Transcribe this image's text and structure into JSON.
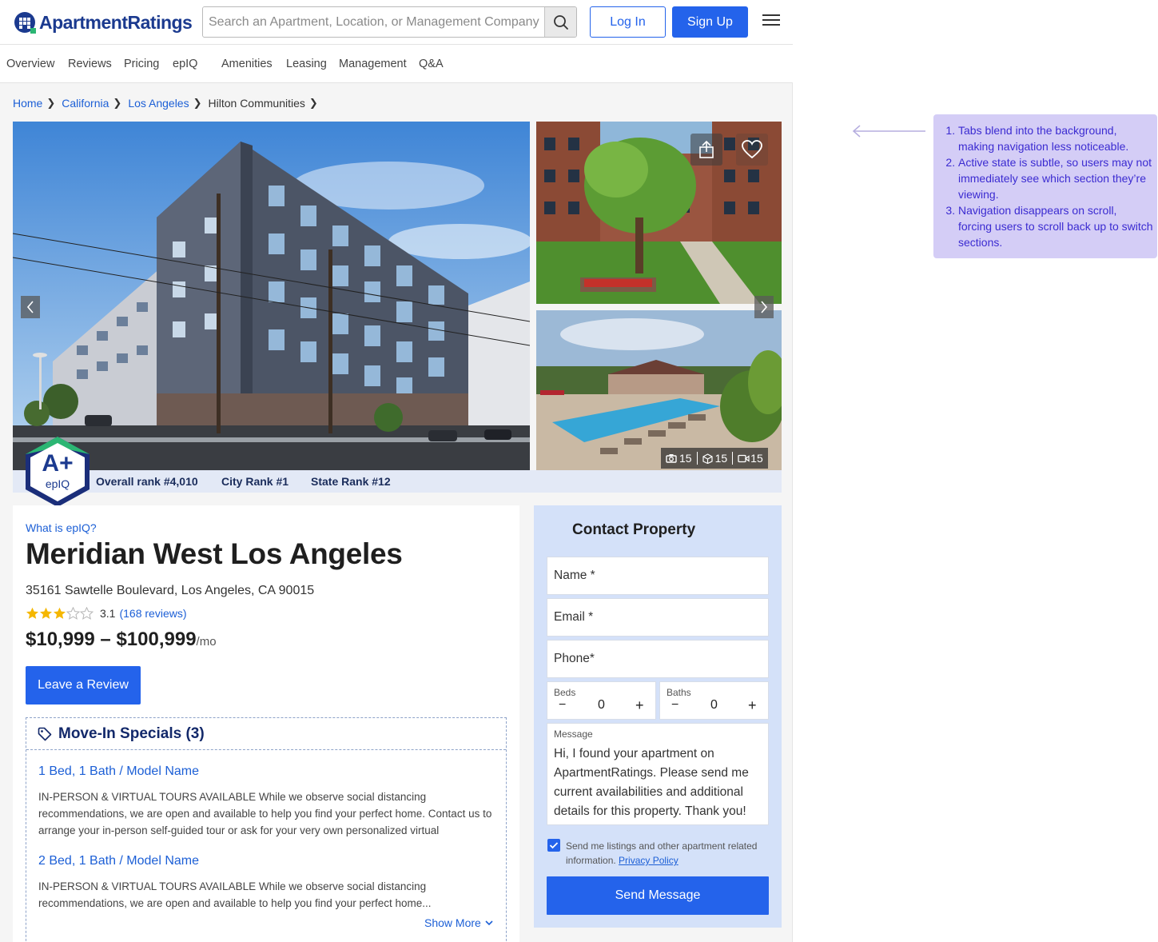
{
  "header": {
    "logo_text": "ApartmentRatings",
    "search_placeholder": "Search an Apartment, Location, or Management Company",
    "login_label": "Log In",
    "signup_label": "Sign Up"
  },
  "tabs": [
    "Overview",
    "Reviews",
    "Pricing",
    "epIQ",
    "Amenities",
    "Leasing",
    "Management",
    "Q&A"
  ],
  "breadcrumb": [
    "Home",
    "California",
    "Los Angeles",
    "Hilton Communities"
  ],
  "gallery": {
    "photo_count": "15",
    "tour_count": "15",
    "video_count": "15"
  },
  "rank": {
    "badge_grade": "A+",
    "badge_label": "epIQ",
    "overall": "Overall rank #4,010",
    "city": "City Rank #1",
    "state": "State Rank #12"
  },
  "property": {
    "what_link": "What is epIQ?",
    "name": "Meridian West Los Angeles",
    "address": "35161 Sawtelle Boulevard, Los Angeles, CA 90015",
    "rating": 3.1,
    "rating_text": "3.1",
    "reviews_link": "(168 reviews)",
    "price": "$10,999 – $100,999",
    "price_unit": "/mo",
    "review_button": "Leave a Review"
  },
  "specials": {
    "title": "Move-In Specials (3)",
    "items": [
      {
        "name": "1 Bed, 1 Bath / Model Name",
        "desc": "IN-PERSON & VIRTUAL TOURS AVAILABLE While we observe social distancing recommendations, we are open and available to help you find your perfect home. Contact us to arrange your in-person self-guided tour or ask for your very own personalized virtual"
      },
      {
        "name": "2 Bed, 1 Bath / Model Name",
        "desc": "IN-PERSON & VIRTUAL TOURS AVAILABLE While we observe social distancing recommendations, we are open and available to help you find your perfect home..."
      }
    ],
    "show_more": "Show More"
  },
  "contact": {
    "title": "Contact Property",
    "name_label": "Name *",
    "email_label": "Email  *",
    "phone_label": "Phone*",
    "beds_label": "Beds",
    "beds_value": "0",
    "baths_label": "Baths",
    "baths_value": "0",
    "minus": "−",
    "plus": "+",
    "message_label": "Message",
    "message_text": "Hi, I found your apartment on ApartmentRatings. Please send me current availabilities and additional details for this property. Thank you!",
    "consent_text": "Send me listings and other apartment related information.",
    "privacy_link": "Privacy Policy",
    "send_button": "Send Message"
  },
  "annotation": {
    "notes": [
      "Tabs blend into the background, making navigation less noticeable.",
      "Active state is subtle, so users may not immediately see which section they’re viewing.",
      "Navigation disappears on scroll, forcing users to scroll back up to switch sections."
    ]
  },
  "colors": {
    "brand_blue": "#2463eb",
    "link_blue": "#1c5fd6",
    "annotation_bg": "#d4cdf6",
    "annotation_text": "#3b2bd1",
    "contact_bg": "#d4e1f9",
    "badge_green": "#2bb673",
    "badge_navy": "#1b2e7a"
  }
}
